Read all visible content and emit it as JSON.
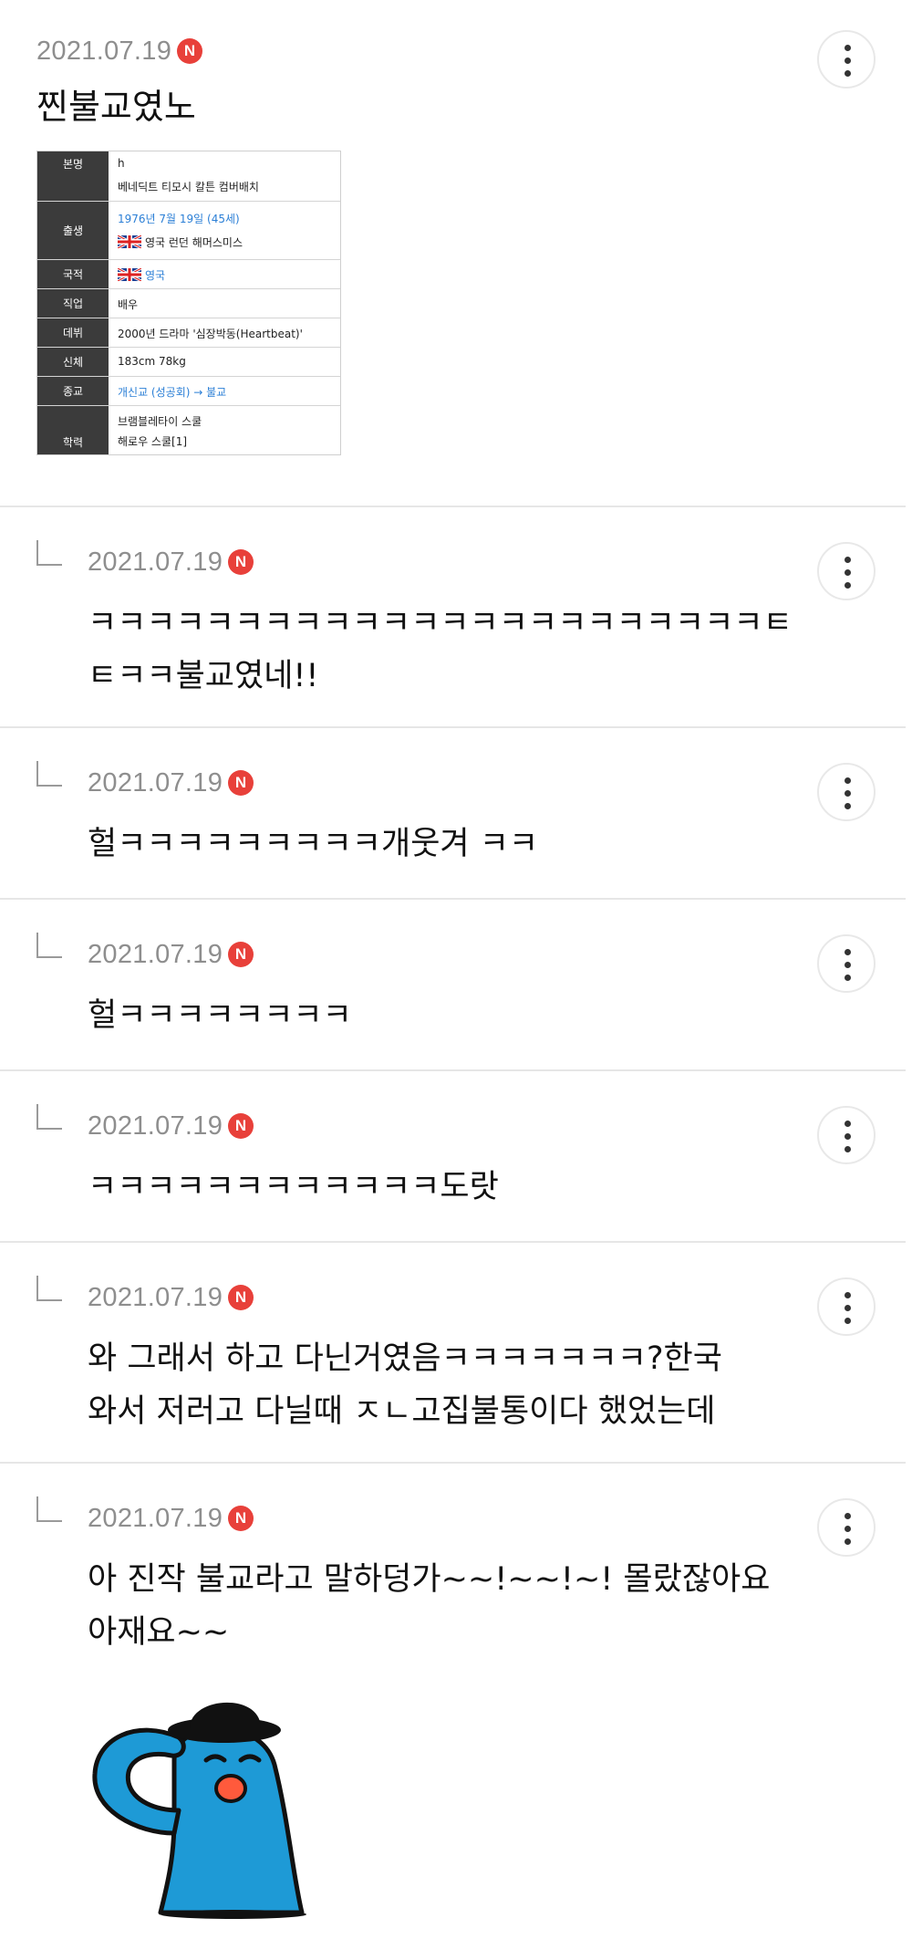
{
  "comments": [
    {
      "date": "2021.07.19",
      "badge": "N",
      "text": "찐불교였노",
      "profile_table": {
        "rows": [
          {
            "key": "본명",
            "lines": [
              "h",
              "베네딕트 티모시 칼튼 컴버배치"
            ]
          },
          {
            "key": "출생",
            "lines": [
              "1976년 7월 19일 (45세)",
              "영국 런던 해머스미스"
            ]
          },
          {
            "key": "국적",
            "lines": [
              "영국"
            ]
          },
          {
            "key": "직업",
            "lines": [
              "배우"
            ]
          },
          {
            "key": "데뷔",
            "lines": [
              "2000년 드라마 '심장박동(Heartbeat)'"
            ]
          },
          {
            "key": "신체",
            "lines": [
              "183cm 78kg"
            ]
          },
          {
            "key": "종교",
            "lines": [
              "개신교 (성공회) → 불교"
            ]
          },
          {
            "key": "학력",
            "lines": [
              "브램블레타이 스쿨",
              "해로우 스쿨[1]"
            ]
          }
        ]
      }
    },
    {
      "date": "2021.07.19",
      "badge": "N",
      "text": "ㅋㅋㅋㅋㅋㅋㅋㅋㅋㅋㅋㅋㅋㅋㅋㅋㅋㅋㅋㅋㅋㅋㅋㅌ\nㅌㅋㅋ불교였네!!"
    },
    {
      "date": "2021.07.19",
      "badge": "N",
      "text": "헐ㅋㅋㅋㅋㅋㅋㅋㅋㅋ개웃겨 ㅋㅋ"
    },
    {
      "date": "2021.07.19",
      "badge": "N",
      "text": "헐ㅋㅋㅋㅋㅋㅋㅋㅋ"
    },
    {
      "date": "2021.07.19",
      "badge": "N",
      "text": "ㅋㅋㅋㅋㅋㅋㅋㅋㅋㅋㅋㅋ도랏"
    },
    {
      "date": "2021.07.19",
      "badge": "N",
      "text": "와 그래서 하고 다닌거였음ㅋㅋㅋㅋㅋㅋㅋ?한국\n와서 저러고 다닐때 ㅈㄴ고집불통이다 했었는데"
    },
    {
      "date": "2021.07.19",
      "badge": "N",
      "text": "아 진작 불교라고 말하덩가~~!~~!~! 몰랐잖아요\n아재요~~",
      "sticker": "blue-character-salute-sticker"
    }
  ],
  "colors": {
    "badge": "#e8403a",
    "date": "#8e8e8e",
    "divider": "#e6e6e6",
    "sticker_body": "#1e9ad6",
    "link": "#2b7fd6"
  }
}
